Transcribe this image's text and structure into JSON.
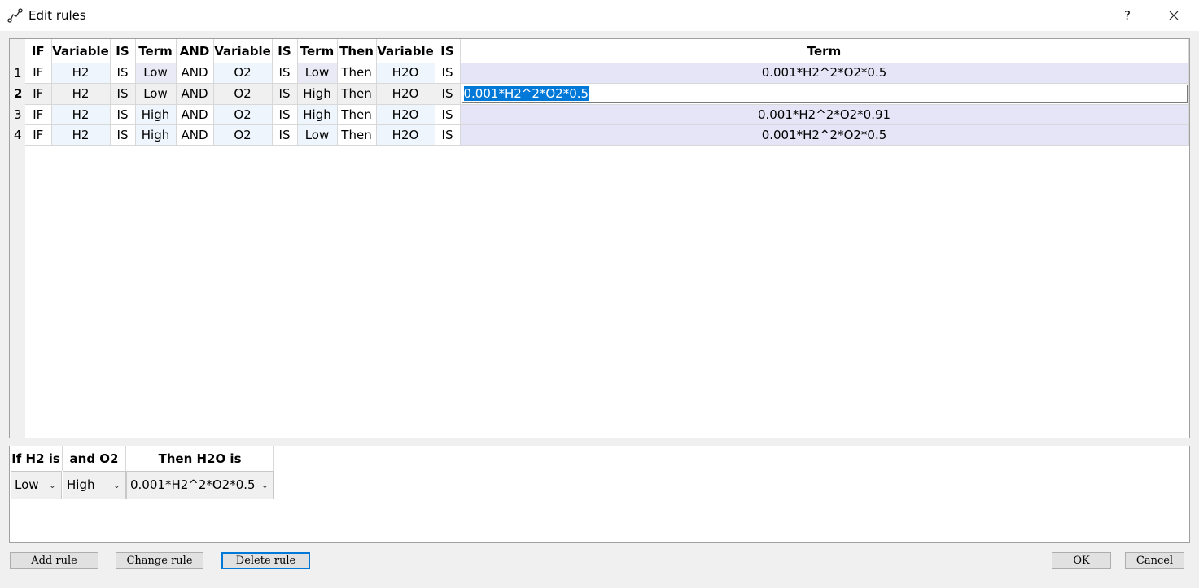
{
  "window": {
    "title": "Edit rules",
    "help_glyph": "?",
    "icon": "graph-icon",
    "close_icon": "close-icon"
  },
  "rules_table": {
    "headers": [
      "IF",
      "Variable",
      "IS",
      "Term",
      "AND",
      "Variable",
      "IS",
      "Term",
      "Then",
      "Variable",
      "IS",
      "Term"
    ],
    "rows": [
      {
        "num": "1",
        "cells": [
          "IF",
          "H2",
          "IS",
          "Low",
          "AND",
          "O2",
          "IS",
          "Low",
          "Then",
          "H2O",
          "IS",
          "0.001*H2^2*O2*0.5"
        ]
      },
      {
        "num": "2",
        "cells": [
          "IF",
          "H2",
          "IS",
          "Low",
          "AND",
          "O2",
          "IS",
          "High",
          "Then",
          "H2O",
          "IS",
          "0.001*H2^2*O2*0.5"
        ]
      },
      {
        "num": "3",
        "cells": [
          "IF",
          "H2",
          "IS",
          "High",
          "AND",
          "O2",
          "IS",
          "High",
          "Then",
          "H2O",
          "IS",
          "0.001*H2^2*O2*0.91"
        ]
      },
      {
        "num": "4",
        "cells": [
          "IF",
          "H2",
          "IS",
          "High",
          "AND",
          "O2",
          "IS",
          "Low",
          "Then",
          "H2O",
          "IS",
          "0.001*H2^2*O2*0.5"
        ]
      }
    ],
    "selected_row": "2",
    "editing_value": "0.001*H2^2*O2*0.5"
  },
  "rule_editor": {
    "h2_label": "If H2 is",
    "o2_label": "and O2 is",
    "h2o_label": "Then H2O is",
    "h2_value": "Low",
    "o2_value": "High",
    "h2o_value": "0.001*H2^2*O2*0.5",
    "dropdown_icon": "chevron-down-icon"
  },
  "buttons": {
    "add": "Add rule",
    "change": "Change rule",
    "delete": "Delete rule",
    "ok": "OK",
    "cancel": "Cancel"
  },
  "colors": {
    "selection": "#0078d7",
    "variable_cell": "#eef5fc",
    "term_cell": "#eaeaf6",
    "output_cell": "#e5e5f7"
  }
}
